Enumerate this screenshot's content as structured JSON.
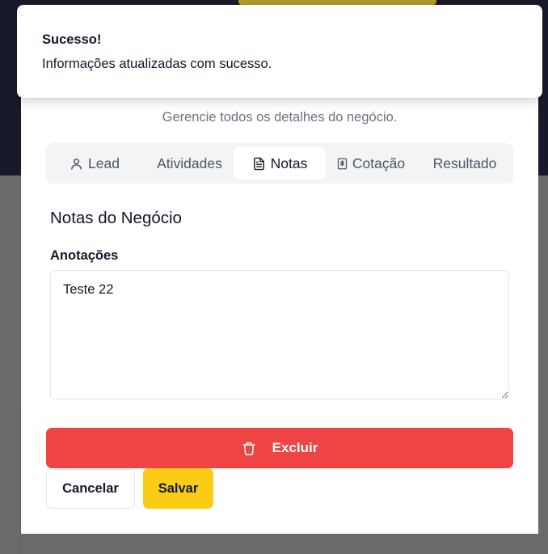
{
  "toast": {
    "title": "Sucesso!",
    "description": "Informações atualizadas com sucesso."
  },
  "dialog": {
    "subtitle": "Gerencie todos os detalhes do negócio.",
    "tabs": [
      {
        "label": "Lead",
        "icon": "user-icon",
        "active": false
      },
      {
        "label": "Atividades",
        "icon": "",
        "active": false
      },
      {
        "label": "Notas",
        "icon": "file-text-icon",
        "active": true
      },
      {
        "label": "Cotação",
        "icon": "dollar-document-icon",
        "active": false
      },
      {
        "label": "Resultado",
        "icon": "",
        "active": false
      }
    ],
    "notes": {
      "section_title": "Notas do Negócio",
      "field_label": "Anotações",
      "value": "Teste 22"
    },
    "actions": {
      "delete_label": "Excluir",
      "delete_icon": "trash-icon",
      "cancel_label": "Cancelar",
      "save_label": "Salvar"
    }
  },
  "colors": {
    "danger": "#ef4444",
    "primary": "#facc15",
    "backdrop_top": "#171a2a"
  }
}
